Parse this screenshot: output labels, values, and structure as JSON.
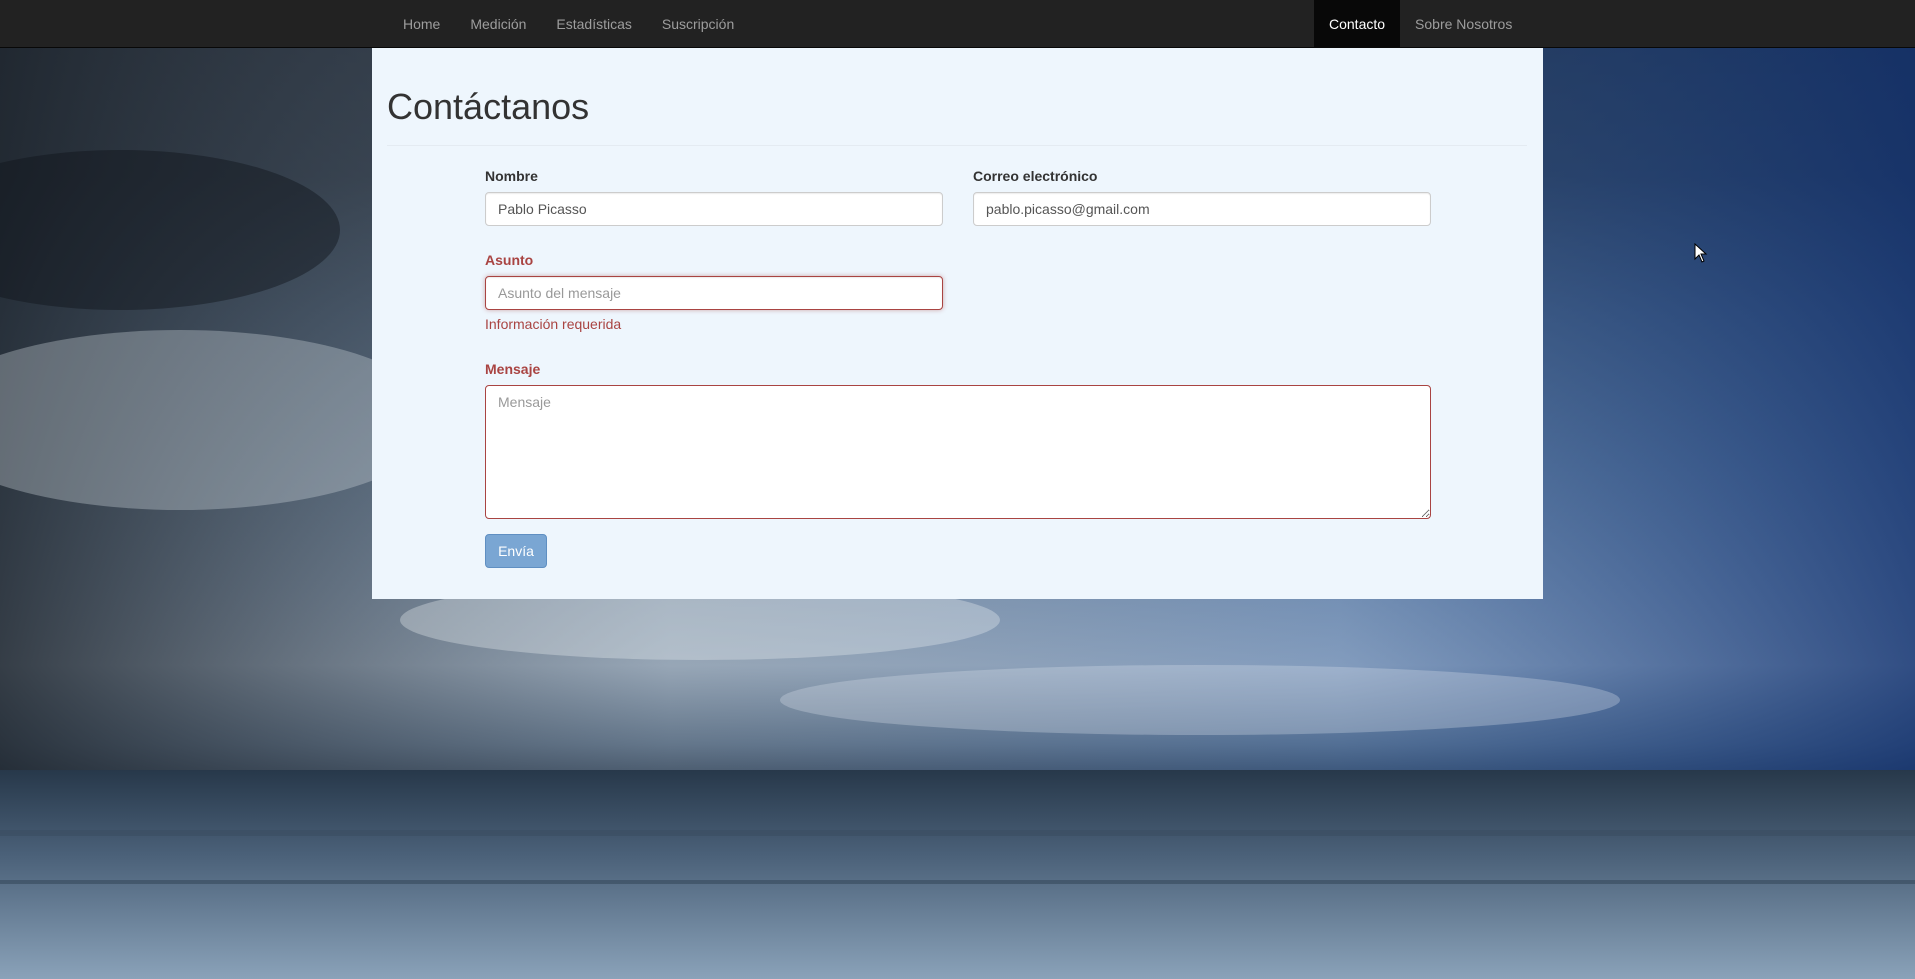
{
  "nav": {
    "left_items": [
      "Home",
      "Medición",
      "Estadísticas",
      "Suscripción"
    ],
    "right_items": [
      "Contacto",
      "Sobre Nosotros"
    ],
    "active": "Contacto"
  },
  "page": {
    "title": "Contáctanos"
  },
  "form": {
    "name": {
      "label": "Nombre",
      "value": "Pablo Picasso",
      "placeholder": "Nombre"
    },
    "email": {
      "label": "Correo electrónico",
      "value": "pablo.picasso@gmail.com",
      "placeholder": "Correo electrónico"
    },
    "subject": {
      "label": "Asunto",
      "value": "",
      "placeholder": "Asunto del mensaje",
      "error": "Información requerida"
    },
    "message": {
      "label": "Mensaje",
      "value": "",
      "placeholder": "Mensaje"
    },
    "submit_label": "Envía"
  },
  "colors": {
    "navbar": "#222222",
    "nav_active": "#080808",
    "panel": "#eef6fd",
    "error": "#a94442",
    "submit": "#7aa6d3"
  }
}
